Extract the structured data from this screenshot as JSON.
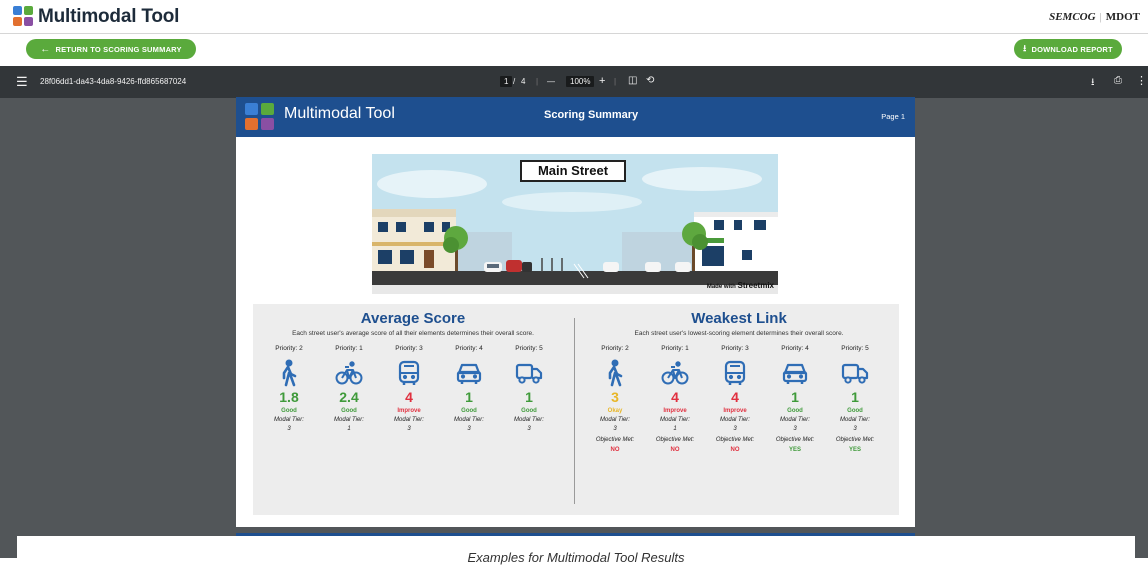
{
  "app": {
    "title": "Multimodal Tool",
    "partners": [
      "SEMCOG",
      "MDOT"
    ],
    "logo_colors": [
      "#3a7fd5",
      "#5aaa3c",
      "#e2702f",
      "#8a4fa3"
    ]
  },
  "actions": {
    "return_label": "RETURN TO SCORING SUMMARY",
    "download_label": "DOWNLOAD REPORT"
  },
  "viewer": {
    "file_id": "28f06dd1-da43-4da8-9426-ffd865687024",
    "page_current": "1",
    "page_separator": "/",
    "page_total": "4",
    "zoom": "100%",
    "minus": "—",
    "plus": "+"
  },
  "report": {
    "header_title": "Multimodal Tool",
    "header_subtitle": "Scoring Summary",
    "page_label": "Page 1",
    "street_name": "Main Street",
    "credit_prefix": "Made with",
    "credit_brand": "Streetmix",
    "average": {
      "title": "Average Score",
      "description": "Each street user's average score of all their elements determines their overall score.",
      "columns": [
        {
          "priority": "Priority: 2",
          "icon": "pedestrian-icon",
          "score": "1.8",
          "rating": "Good",
          "tier_label": "Modal Tier:",
          "tier": "3"
        },
        {
          "priority": "Priority: 1",
          "icon": "bicycle-icon",
          "score": "2.4",
          "rating": "Good",
          "tier_label": "Modal Tier:",
          "tier": "1"
        },
        {
          "priority": "Priority: 3",
          "icon": "bus-icon",
          "score": "4",
          "rating": "Improve",
          "tier_label": "Modal Tier:",
          "tier": "3"
        },
        {
          "priority": "Priority: 4",
          "icon": "car-icon",
          "score": "1",
          "rating": "Good",
          "tier_label": "Modal Tier:",
          "tier": "3"
        },
        {
          "priority": "Priority: 5",
          "icon": "truck-icon",
          "score": "1",
          "rating": "Good",
          "tier_label": "Modal Tier:",
          "tier": "3"
        }
      ]
    },
    "weakest": {
      "title": "Weakest Link",
      "description": "Each street user's lowest-scoring element determines their overall score.",
      "columns": [
        {
          "priority": "Priority: 2",
          "icon": "pedestrian-icon",
          "score": "3",
          "rating": "Okay",
          "tier_label": "Modal Tier:",
          "tier": "3",
          "objective_label": "Objective Met:",
          "objective": "NO"
        },
        {
          "priority": "Priority: 1",
          "icon": "bicycle-icon",
          "score": "4",
          "rating": "Improve",
          "tier_label": "Modal Tier:",
          "tier": "1",
          "objective_label": "Objective Met:",
          "objective": "NO"
        },
        {
          "priority": "Priority: 3",
          "icon": "bus-icon",
          "score": "4",
          "rating": "Improve",
          "tier_label": "Modal Tier:",
          "tier": "3",
          "objective_label": "Objective Met:",
          "objective": "NO"
        },
        {
          "priority": "Priority: 4",
          "icon": "car-icon",
          "score": "1",
          "rating": "Good",
          "tier_label": "Modal Tier:",
          "tier": "3",
          "objective_label": "Objective Met:",
          "objective": "YES"
        },
        {
          "priority": "Priority: 5",
          "icon": "truck-icon",
          "score": "1",
          "rating": "Good",
          "tier_label": "Modal Tier:",
          "tier": "3",
          "objective_label": "Objective Met:",
          "objective": "YES"
        }
      ]
    }
  },
  "colors": {
    "good": "#3f9a3a",
    "okay": "#e8b627",
    "improve": "#e0303f",
    "icon_blue": "#2f6db5",
    "header_blue": "#1e4f8f",
    "action_green": "#5aaa3c"
  },
  "caption": "Examples for Multimodal Tool Results"
}
